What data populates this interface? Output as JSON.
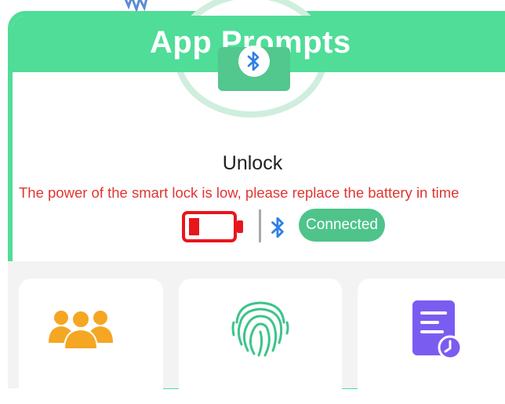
{
  "banner": {
    "title": "App Prompts"
  },
  "lock": {
    "status_title": "Unlock",
    "warning": "The power of the smart lock is low, please replace the battery in time",
    "battery_level": 0.25,
    "connection_label": "Connected"
  },
  "icons": {
    "header": "bluetooth-icon",
    "status": [
      "battery-low-icon",
      "bluetooth-icon"
    ],
    "menu": [
      "users-icon",
      "fingerprint-icon",
      "log-icon"
    ]
  },
  "colors": {
    "accent": "#4fdd98",
    "warning": "#e03530",
    "pill": "#4ec48a",
    "users_icon": "#f5a623",
    "log_icon": "#7b5cf0"
  }
}
